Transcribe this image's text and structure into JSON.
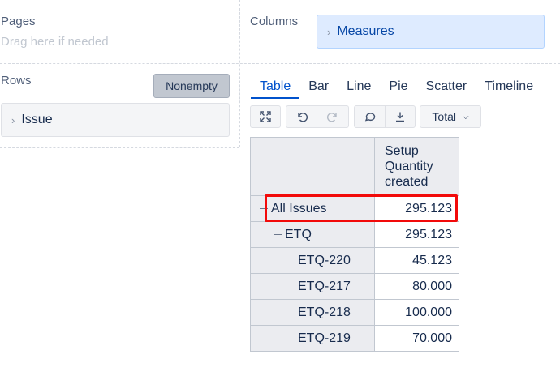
{
  "pages": {
    "label": "Pages",
    "hint": "Drag here if needed"
  },
  "columns": {
    "label": "Columns",
    "chip": "Measures"
  },
  "rows": {
    "label": "Rows",
    "chip": "Issue",
    "nonempty": "Nonempty"
  },
  "tabs": [
    "Table",
    "Bar",
    "Line",
    "Pie",
    "Scatter",
    "Timeline"
  ],
  "active_tab": "Table",
  "toolbar": {
    "icons": [
      "expand-icon",
      "undo-icon",
      "redo-icon",
      "comment-icon",
      "download-icon"
    ],
    "total_label": "Total"
  },
  "table": {
    "measure_header": [
      "Setup",
      "Quantity",
      "created"
    ],
    "rows": [
      {
        "label": "All Issues",
        "value": "295.123",
        "level": 0,
        "expanded": true
      },
      {
        "label": "ETQ",
        "value": "295.123",
        "level": 1,
        "expanded": true
      },
      {
        "label": "ETQ-220",
        "value": "45.123",
        "level": 2
      },
      {
        "label": "ETQ-217",
        "value": "80.000",
        "level": 2
      },
      {
        "label": "ETQ-218",
        "value": "100.000",
        "level": 2
      },
      {
        "label": "ETQ-219",
        "value": "70.000",
        "level": 2
      }
    ]
  },
  "highlight_color": "#f20a0a",
  "accent_color": "#0052cc"
}
